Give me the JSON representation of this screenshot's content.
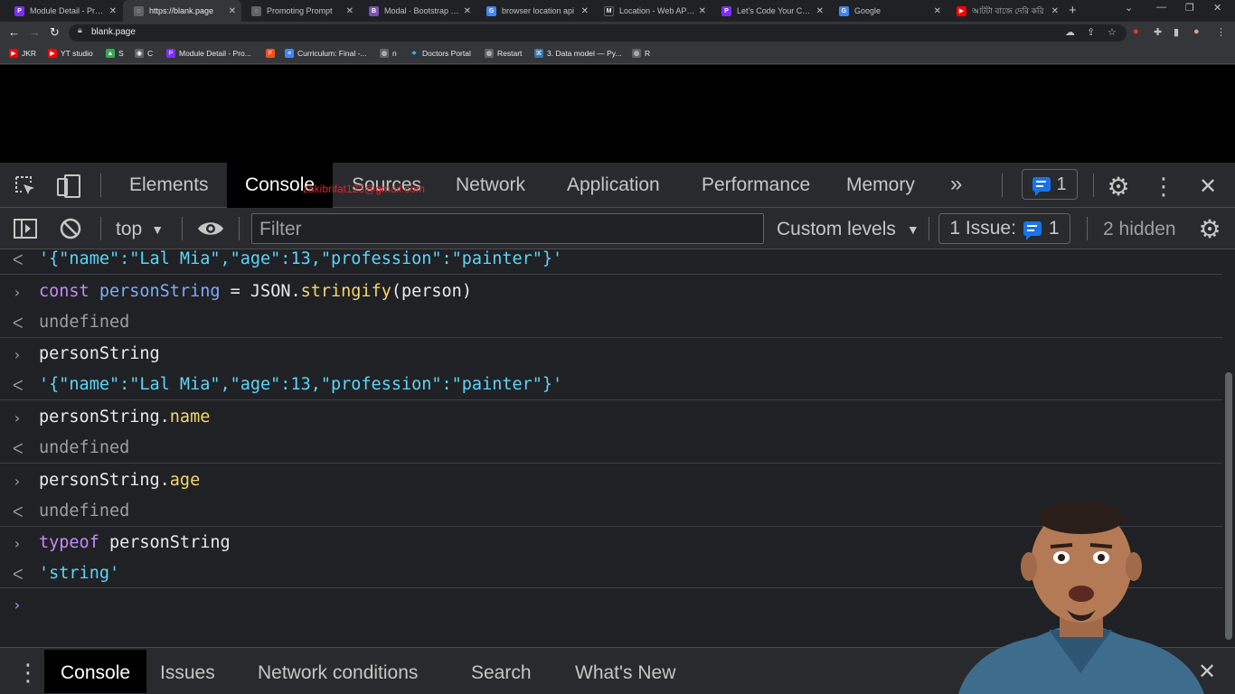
{
  "browser": {
    "tabs": [
      {
        "title": "Module Detail - Progr",
        "color": "#7b2ff7",
        "glyph": "P",
        "active": false
      },
      {
        "title": "https://blank.page",
        "color": "#5f6368",
        "glyph": "",
        "active": true
      },
      {
        "title": "Promoting Prompt",
        "color": "#5f6368",
        "glyph": "",
        "active": false
      },
      {
        "title": "Modal · Bootstrap v5.3",
        "color": "#7952b3",
        "glyph": "B",
        "active": false
      },
      {
        "title": "browser location api",
        "color": "#4285f4",
        "glyph": "G",
        "active": false
      },
      {
        "title": "Location - Web APIs |",
        "color": "#202124",
        "glyph": "M",
        "active": false
      },
      {
        "title": "Let's Code Your Caree",
        "color": "#7b2ff7",
        "glyph": "P",
        "active": false
      },
      {
        "title": "Google",
        "color": "#4285f4",
        "glyph": "G",
        "active": false
      },
      {
        "title": "আটটা বাজে দেরি করি",
        "color": "#ff0000",
        "glyph": "▶",
        "active": false
      }
    ],
    "url": "blank.page",
    "bookmarks": [
      {
        "label": "JKR",
        "color": "#ff0000"
      },
      {
        "label": "YT studio",
        "color": "#ff0000"
      },
      {
        "label": "S",
        "color": "#34a853"
      },
      {
        "label": "C",
        "color": "#5f6368"
      },
      {
        "label": "Module Detail - Pro...",
        "color": "#7b2ff7"
      },
      {
        "label": "",
        "color": "#f24e1e"
      },
      {
        "label": "Curriculum: Final -...",
        "color": "#4285f4"
      },
      {
        "label": "n",
        "color": "#5f6368"
      },
      {
        "label": "Doctors Portal",
        "color": "#61dafb"
      },
      {
        "label": "Restart",
        "color": "#5f6368"
      },
      {
        "label": "3. Data model — Py...",
        "color": "#3776ab"
      },
      {
        "label": "R",
        "color": "#5f6368"
      }
    ]
  },
  "devtools": {
    "tabs": [
      "Elements",
      "Console",
      "Sources",
      "Network",
      "Application",
      "Performance",
      "Memory"
    ],
    "active_tab": "Console",
    "issue_count": "1",
    "watermark": "zakibrifat123@gmail.com",
    "toolbar": {
      "context": "top",
      "filter_placeholder": "Filter",
      "levels": "Custom levels",
      "issues_label": "1 Issue:",
      "issues_count": "1",
      "hidden": "2 hidden"
    },
    "console_lines": {
      "l1": "'{\"name\":\"Lal Mia\",\"age\":13,\"profession\":\"painter\"}'",
      "l2_kw": "const",
      "l2_var": "personString",
      "l2_eq": " = JSON.",
      "l2_fn": "stringify",
      "l2_arg": "(person)",
      "l3": "undefined",
      "l4": "personString",
      "l5": "'{\"name\":\"Lal Mia\",\"age\":13,\"profession\":\"painter\"}'",
      "l6_obj": "personString.",
      "l6_prop": "name",
      "l7": "undefined",
      "l8_obj": "personString.",
      "l8_prop": "age",
      "l9": "undefined",
      "l10_kw": "typeof",
      "l10_var": " personString",
      "l11": "'string'"
    },
    "drawer_tabs": [
      "Console",
      "Issues",
      "Network conditions",
      "Search",
      "What's New"
    ]
  }
}
